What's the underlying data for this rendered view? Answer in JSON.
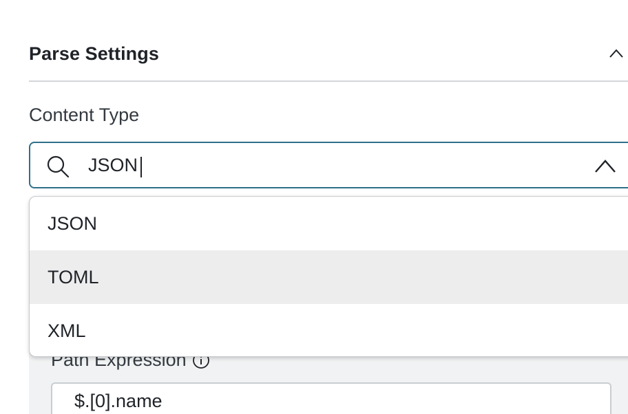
{
  "section": {
    "title": "Parse Settings"
  },
  "content_type": {
    "label": "Content Type",
    "input_value": "JSON",
    "options": [
      {
        "label": "JSON"
      },
      {
        "label": "TOML"
      },
      {
        "label": "XML"
      }
    ],
    "highlighted_option": "TOML"
  },
  "path": {
    "label": "Path Expression",
    "value": "$.[0].name"
  },
  "icons": {
    "collapse": "chevron-up-icon",
    "search": "search-icon",
    "dropdown_toggle": "chevron-up-icon",
    "info": "info-icon"
  },
  "colors": {
    "focus_border": "#2e6f8a",
    "highlight_bg": "#ededee",
    "nested_panel_bg": "#f1f2f3"
  }
}
